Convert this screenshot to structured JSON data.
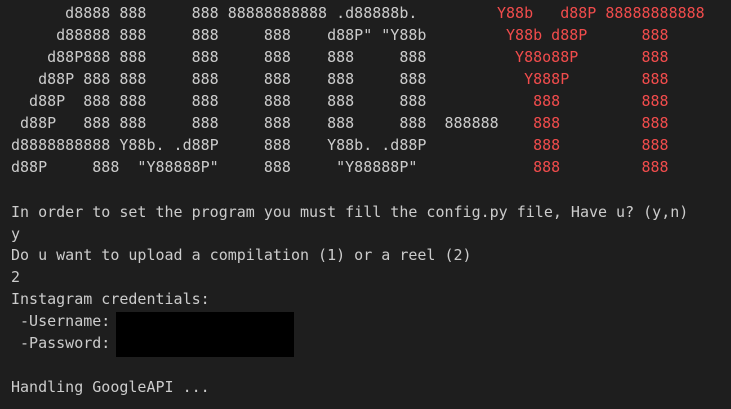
{
  "terminal": {
    "banner": {
      "white_lines": [
        "      d8888 888     888 88888888888 .d88888b.",
        "     d88888 888     888     888    d88P\" \"Y88b",
        "    d88P888 888     888     888    888     888",
        "   d88P 888 888     888     888    888     888",
        "  d88P  888 888     888     888    888     888",
        " d88P   888 888     888     888    888     888  888888",
        "d8888888888 Y88b. .d88P     888    Y88b. .d88P",
        "d88P     888  \"Y88888P\"     888     \"Y88888P\""
      ],
      "red_lines": [
        "Y88b   d88P 88888888888",
        " Y88b d88P      888",
        "  Y88o88P       888",
        "   Y888P        888",
        "    888         888",
        "    888         888",
        "    888         888",
        "    888         888"
      ]
    },
    "output": {
      "config_prompt": "In order to set the program you must fill the config.py file, Have u? (y,n)",
      "config_answer": "y",
      "upload_prompt": "Do u want to upload a compilation (1) or a reel (2)",
      "upload_answer": "2",
      "credentials_heading": "Instagram credentials:",
      "username_label": " -Username:",
      "password_label": " -Password:",
      "handling_message": "Handling GoogleAPI ..."
    }
  }
}
